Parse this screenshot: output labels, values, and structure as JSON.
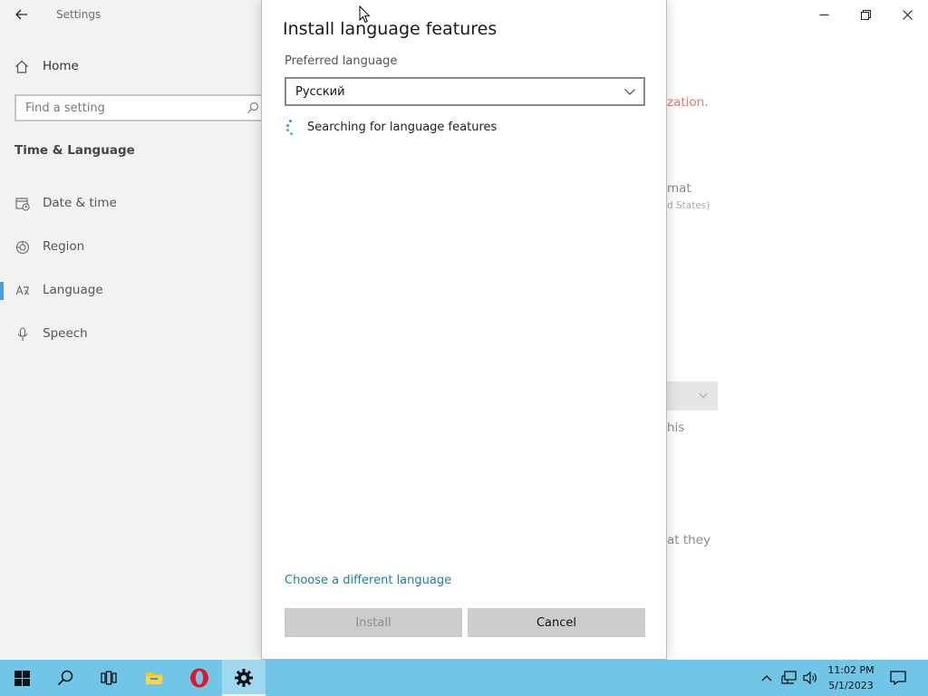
{
  "settings": {
    "title": "Settings",
    "home_label": "Home",
    "search_placeholder": "Find a setting",
    "section_title": "Time & Language",
    "nav": [
      {
        "label": "Date & time",
        "icon": "date-time-icon"
      },
      {
        "label": "Region",
        "icon": "region-globe-icon"
      },
      {
        "label": "Language",
        "icon": "language-icon",
        "active": true
      },
      {
        "label": "Speech",
        "icon": "microphone-icon"
      }
    ],
    "background_fragments": {
      "warning_fragment": "zation.",
      "format_fragment": "mat",
      "format_sub_fragment": "d States)",
      "this_fragment": "his",
      "they_fragment": "at they"
    }
  },
  "dialog": {
    "title": "Install language features",
    "preferred_label": "Preferred language",
    "selected_language": "Русский",
    "status_text": "Searching for language features",
    "change_link": "Choose a different language",
    "install_label": "Install",
    "cancel_label": "Cancel"
  },
  "taskbar": {
    "time": "11:02 PM",
    "date": "5/1/2023",
    "apps": [
      "start-icon",
      "search-icon",
      "task-view-icon",
      "file-explorer-icon",
      "opera-icon",
      "settings-gear-icon"
    ]
  },
  "colors": {
    "taskbar": "#6fc6e6",
    "accent_link": "#1a7fa0",
    "opera_red": "#e2162a",
    "nav_active": "#4aa0d6"
  }
}
